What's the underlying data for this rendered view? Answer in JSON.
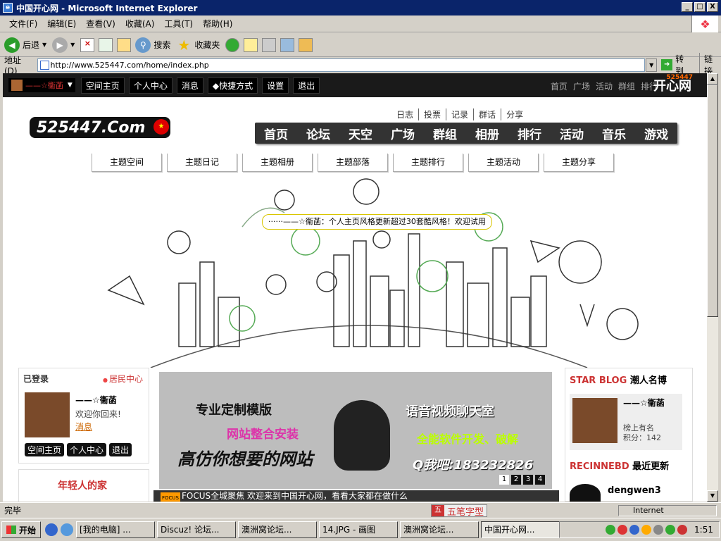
{
  "window": {
    "title": "中国开心网 - Microsoft Internet Explorer",
    "min": "_",
    "max": "□",
    "close": "X"
  },
  "menu": [
    "文件(F)",
    "编辑(E)",
    "查看(V)",
    "收藏(A)",
    "工具(T)",
    "帮助(H)"
  ],
  "toolbar": {
    "back": "后退",
    "search": "搜索",
    "favorites": "收藏夹"
  },
  "address": {
    "label": "地址(D)",
    "url": "http://www.525447.com/home/index.php",
    "go": "转到",
    "links": "链接"
  },
  "site": {
    "user": "——☆衞菡",
    "topnav": [
      "空间主页",
      "个人中心",
      "消息",
      "◆快捷方式",
      "设置",
      "退出"
    ],
    "topnav_right": [
      "首页",
      "广场",
      "活动",
      "群组",
      "排行"
    ],
    "kaixin": "开心网",
    "kaixin_num": "525447",
    "logo": "525447.Com",
    "sublinks": [
      "日志",
      "投票",
      "记录",
      "群话",
      "分享"
    ],
    "mainnav": [
      "首页",
      "论坛",
      "天空",
      "广场",
      "群组",
      "相册",
      "排行",
      "活动",
      "音乐",
      "游戏"
    ],
    "themes": [
      "主题空间",
      "主题日记",
      "主题相册",
      "主题部落",
      "主题排行",
      "主题活动",
      "主题分享"
    ],
    "bubble": "······——☆衞菡：个人主页风格更新超过30套酷风格！欢迎试用",
    "login": {
      "heading": "已登录",
      "resident": "居民中心",
      "name": "——☆衞菡",
      "welcome": "欢迎你回来!",
      "message": "消息",
      "buttons": [
        "空间主页",
        "个人中心",
        "退出"
      ]
    },
    "promo": "年轻人的家",
    "banner": {
      "t1": "专业定制模版",
      "t2": "网站整合安装",
      "t3": "高仿你想要的网站",
      "t4": "语音视频聊天室",
      "t5": "全能软件开发、破解",
      "t6": "Q我吧:183232826",
      "pages": [
        "1",
        "2",
        "3",
        "4"
      ]
    },
    "focus": {
      "tag": "FOCUS",
      "text": "FOCUS全城聚焦  欢迎来到中国开心网，看看大家都在做什么"
    },
    "star_blog": {
      "heading_o": "STAR BLOG",
      "heading": "潮人名博",
      "name": "——☆衞菡",
      "line1": "榜上有名",
      "line2": "积分：142"
    },
    "recent": {
      "heading_o": "RECINNEBD",
      "heading": "最近更新",
      "user": "dengwen3"
    }
  },
  "status": {
    "text": "完毕",
    "ime": "五笔字型",
    "zone": "Internet"
  },
  "taskbar": {
    "start": "开始",
    "tasks": [
      "[我的电脑] ...",
      "Discuz! 论坛...",
      "澳洲窝论坛...",
      "14.JPG - 画图",
      "澳洲窝论坛...",
      "中国开心网..."
    ],
    "clock": "1:51"
  }
}
